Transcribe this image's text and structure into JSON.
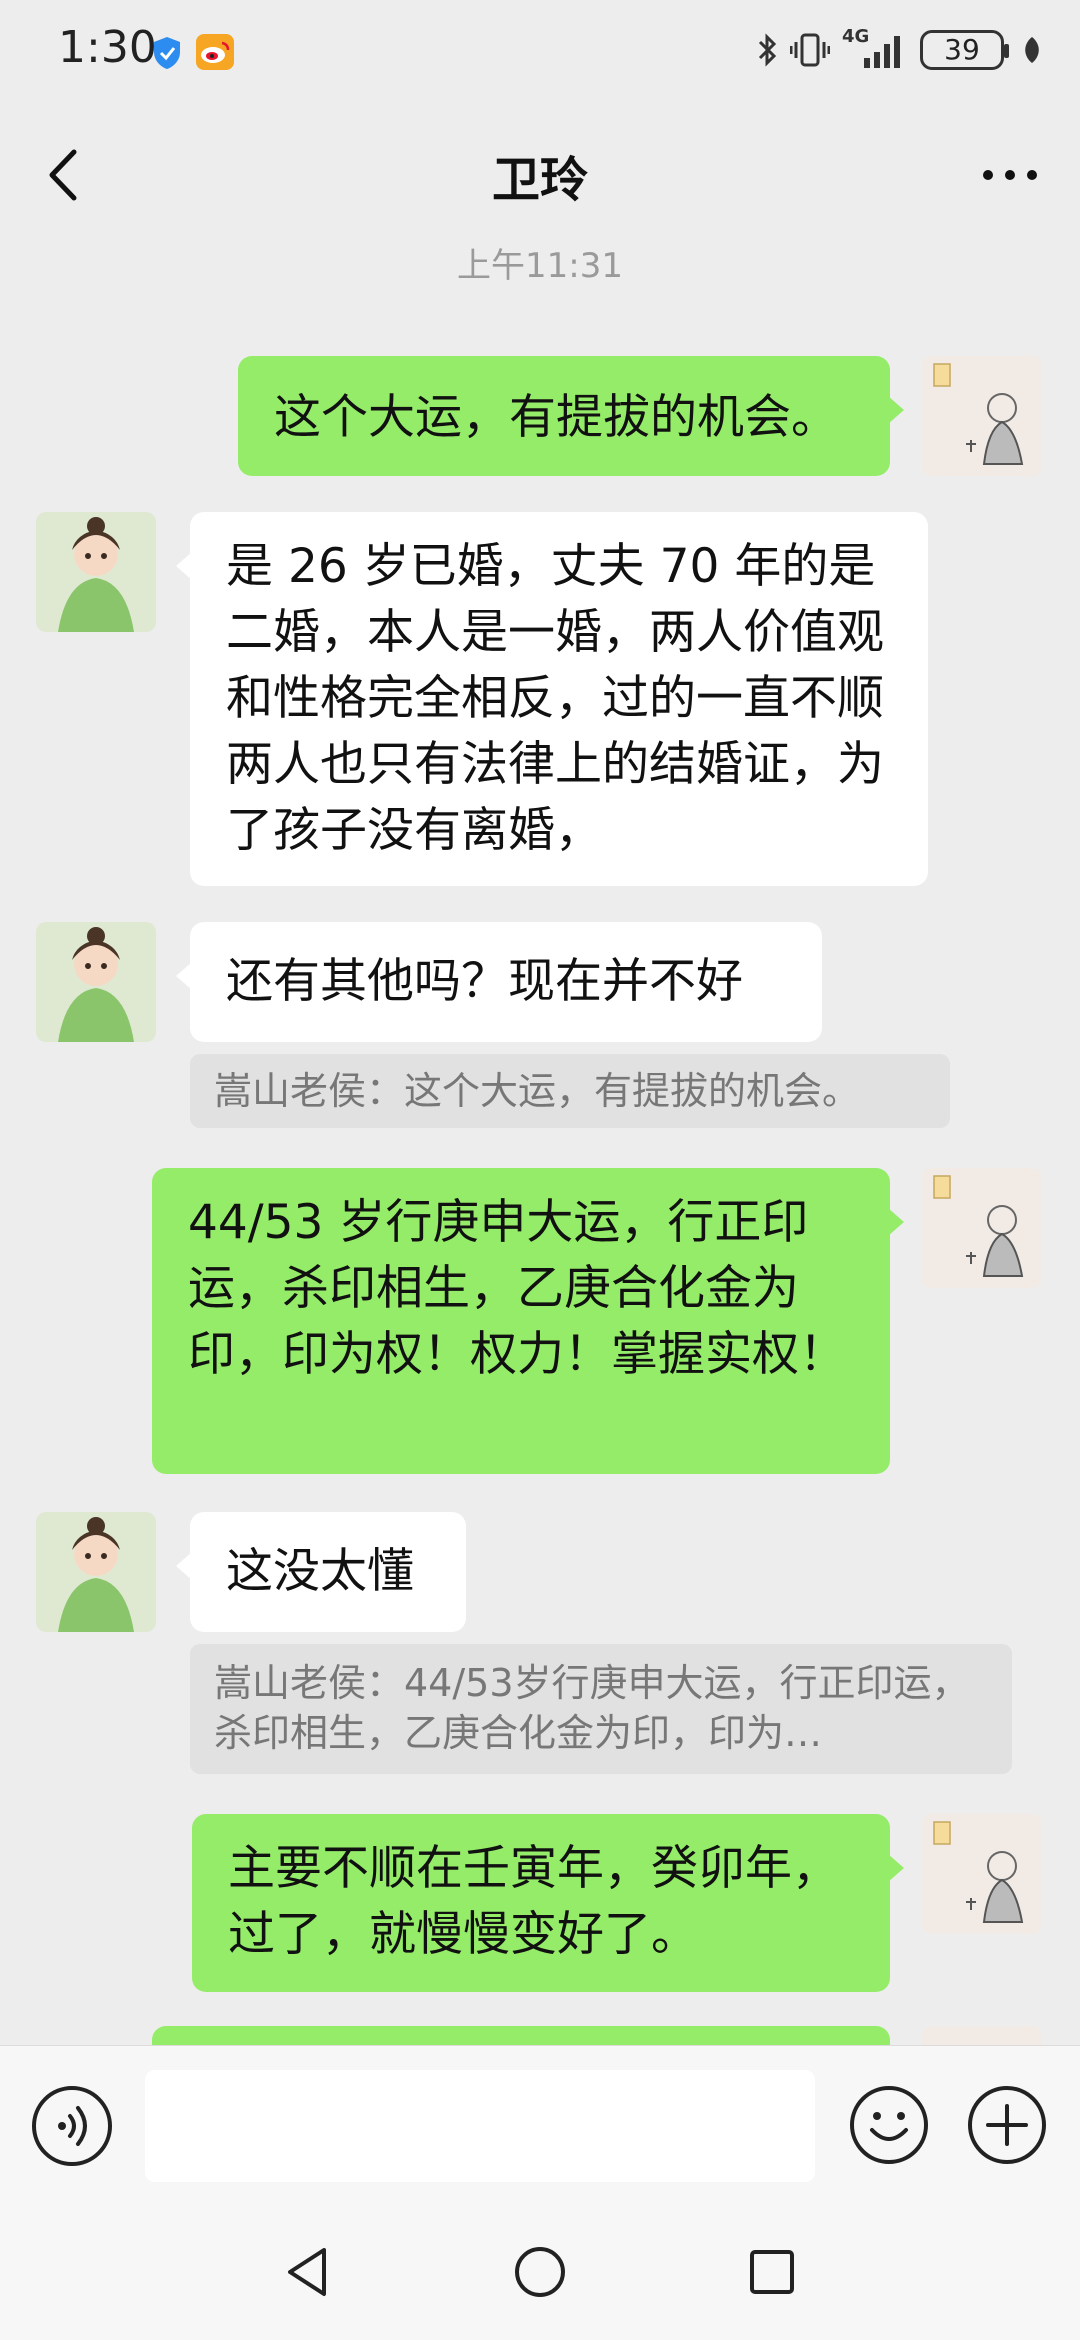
{
  "status_bar": {
    "time": "1:30",
    "network": "4G",
    "battery": "39"
  },
  "header": {
    "title": "卫玲"
  },
  "time_divider": "上午11:31",
  "messages": [
    {
      "text": "这个大运，有提拔的机会。"
    },
    {
      "text": "是 26 岁已婚，丈夫 70 年的是二婚，本人是一婚，两人价值观和性格完全相反，过的一直不顺两人也只有法律上的结婚证，为了孩子没有离婚，"
    },
    {
      "text": "还有其他吗？现在并不好",
      "quote": "嵩山老侯：这个大运，有提拔的机会。"
    },
    {
      "text": "44/53 岁行庚申大运，行正印运，杀印相生，乙庚合化金为印，印为权！权力！掌握实权！"
    },
    {
      "text": "这没太懂",
      "quote": "嵩山老侯：44/53岁行庚申大运，行正印运，杀印相生，乙庚合化金为印，印为…"
    },
    {
      "text": "主要不顺在壬寅年，癸卯年，过了，就慢慢变好了。"
    }
  ],
  "input": {
    "value": ""
  },
  "colors": {
    "my_bubble": "#95ec69",
    "their_bubble": "#ffffff",
    "background": "#ededed"
  },
  "icons": [
    "back-icon",
    "more-icon",
    "voice-icon",
    "emoji-icon",
    "plus-icon",
    "android-back-icon",
    "android-home-icon",
    "android-recents-icon"
  ]
}
